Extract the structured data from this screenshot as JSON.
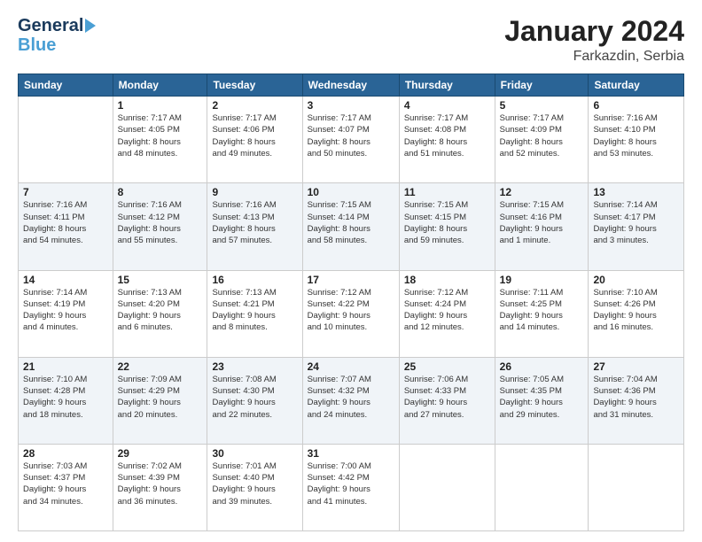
{
  "header": {
    "logo_line1": "General",
    "logo_line2": "Blue",
    "month": "January 2024",
    "location": "Farkazdin, Serbia"
  },
  "columns": [
    "Sunday",
    "Monday",
    "Tuesday",
    "Wednesday",
    "Thursday",
    "Friday",
    "Saturday"
  ],
  "weeks": [
    [
      {
        "day": "",
        "info": ""
      },
      {
        "day": "1",
        "info": "Sunrise: 7:17 AM\nSunset: 4:05 PM\nDaylight: 8 hours\nand 48 minutes."
      },
      {
        "day": "2",
        "info": "Sunrise: 7:17 AM\nSunset: 4:06 PM\nDaylight: 8 hours\nand 49 minutes."
      },
      {
        "day": "3",
        "info": "Sunrise: 7:17 AM\nSunset: 4:07 PM\nDaylight: 8 hours\nand 50 minutes."
      },
      {
        "day": "4",
        "info": "Sunrise: 7:17 AM\nSunset: 4:08 PM\nDaylight: 8 hours\nand 51 minutes."
      },
      {
        "day": "5",
        "info": "Sunrise: 7:17 AM\nSunset: 4:09 PM\nDaylight: 8 hours\nand 52 minutes."
      },
      {
        "day": "6",
        "info": "Sunrise: 7:16 AM\nSunset: 4:10 PM\nDaylight: 8 hours\nand 53 minutes."
      }
    ],
    [
      {
        "day": "7",
        "info": "Sunrise: 7:16 AM\nSunset: 4:11 PM\nDaylight: 8 hours\nand 54 minutes."
      },
      {
        "day": "8",
        "info": "Sunrise: 7:16 AM\nSunset: 4:12 PM\nDaylight: 8 hours\nand 55 minutes."
      },
      {
        "day": "9",
        "info": "Sunrise: 7:16 AM\nSunset: 4:13 PM\nDaylight: 8 hours\nand 57 minutes."
      },
      {
        "day": "10",
        "info": "Sunrise: 7:15 AM\nSunset: 4:14 PM\nDaylight: 8 hours\nand 58 minutes."
      },
      {
        "day": "11",
        "info": "Sunrise: 7:15 AM\nSunset: 4:15 PM\nDaylight: 8 hours\nand 59 minutes."
      },
      {
        "day": "12",
        "info": "Sunrise: 7:15 AM\nSunset: 4:16 PM\nDaylight: 9 hours\nand 1 minute."
      },
      {
        "day": "13",
        "info": "Sunrise: 7:14 AM\nSunset: 4:17 PM\nDaylight: 9 hours\nand 3 minutes."
      }
    ],
    [
      {
        "day": "14",
        "info": "Sunrise: 7:14 AM\nSunset: 4:19 PM\nDaylight: 9 hours\nand 4 minutes."
      },
      {
        "day": "15",
        "info": "Sunrise: 7:13 AM\nSunset: 4:20 PM\nDaylight: 9 hours\nand 6 minutes."
      },
      {
        "day": "16",
        "info": "Sunrise: 7:13 AM\nSunset: 4:21 PM\nDaylight: 9 hours\nand 8 minutes."
      },
      {
        "day": "17",
        "info": "Sunrise: 7:12 AM\nSunset: 4:22 PM\nDaylight: 9 hours\nand 10 minutes."
      },
      {
        "day": "18",
        "info": "Sunrise: 7:12 AM\nSunset: 4:24 PM\nDaylight: 9 hours\nand 12 minutes."
      },
      {
        "day": "19",
        "info": "Sunrise: 7:11 AM\nSunset: 4:25 PM\nDaylight: 9 hours\nand 14 minutes."
      },
      {
        "day": "20",
        "info": "Sunrise: 7:10 AM\nSunset: 4:26 PM\nDaylight: 9 hours\nand 16 minutes."
      }
    ],
    [
      {
        "day": "21",
        "info": "Sunrise: 7:10 AM\nSunset: 4:28 PM\nDaylight: 9 hours\nand 18 minutes."
      },
      {
        "day": "22",
        "info": "Sunrise: 7:09 AM\nSunset: 4:29 PM\nDaylight: 9 hours\nand 20 minutes."
      },
      {
        "day": "23",
        "info": "Sunrise: 7:08 AM\nSunset: 4:30 PM\nDaylight: 9 hours\nand 22 minutes."
      },
      {
        "day": "24",
        "info": "Sunrise: 7:07 AM\nSunset: 4:32 PM\nDaylight: 9 hours\nand 24 minutes."
      },
      {
        "day": "25",
        "info": "Sunrise: 7:06 AM\nSunset: 4:33 PM\nDaylight: 9 hours\nand 27 minutes."
      },
      {
        "day": "26",
        "info": "Sunrise: 7:05 AM\nSunset: 4:35 PM\nDaylight: 9 hours\nand 29 minutes."
      },
      {
        "day": "27",
        "info": "Sunrise: 7:04 AM\nSunset: 4:36 PM\nDaylight: 9 hours\nand 31 minutes."
      }
    ],
    [
      {
        "day": "28",
        "info": "Sunrise: 7:03 AM\nSunset: 4:37 PM\nDaylight: 9 hours\nand 34 minutes."
      },
      {
        "day": "29",
        "info": "Sunrise: 7:02 AM\nSunset: 4:39 PM\nDaylight: 9 hours\nand 36 minutes."
      },
      {
        "day": "30",
        "info": "Sunrise: 7:01 AM\nSunset: 4:40 PM\nDaylight: 9 hours\nand 39 minutes."
      },
      {
        "day": "31",
        "info": "Sunrise: 7:00 AM\nSunset: 4:42 PM\nDaylight: 9 hours\nand 41 minutes."
      },
      {
        "day": "",
        "info": ""
      },
      {
        "day": "",
        "info": ""
      },
      {
        "day": "",
        "info": ""
      }
    ]
  ]
}
